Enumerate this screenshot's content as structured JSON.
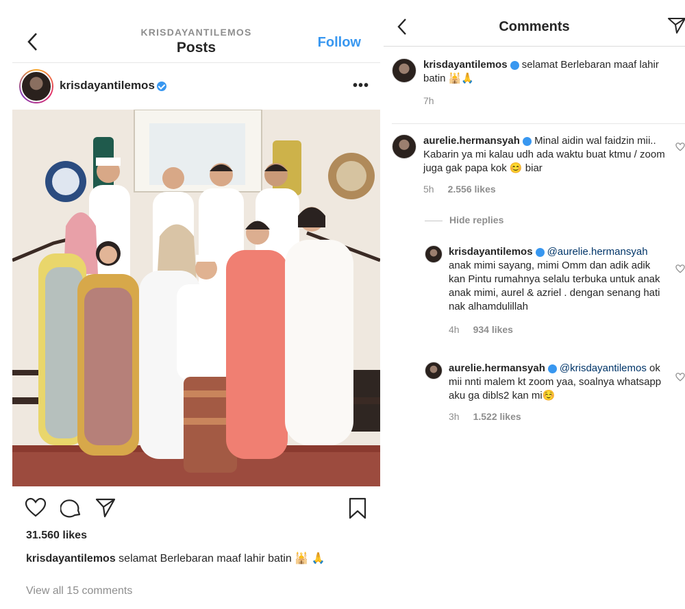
{
  "left": {
    "header": {
      "account_label": "KRISDAYANTILEMOS",
      "title": "Posts",
      "follow_label": "Follow"
    },
    "post": {
      "username": "krisdayantilemos",
      "likes": "31.560 likes",
      "caption_username": "krisdayantilemos",
      "caption_text": " selamat Berlebaran maaf lahir batin 🕌 🙏",
      "view_all_comments": "View all 15 comments"
    },
    "icons": {
      "back": "chevron-left-icon",
      "more": "more-horizontal-icon",
      "like": "heart-icon",
      "comment": "comment-icon",
      "share": "paper-plane-icon",
      "save": "bookmark-icon"
    },
    "colors": {
      "follow": "#3897f0",
      "muted": "#8e8e8e",
      "text": "#262626"
    }
  },
  "right": {
    "header": {
      "title": "Comments"
    },
    "caption": {
      "username": "krisdayantilemos",
      "text": " selamat Berlebaran maaf lahir batin 🕌🙏",
      "time": "7h"
    },
    "comments": [
      {
        "username": "aurelie.hermansyah",
        "mention": "",
        "text": " Minal aidin wal faidzin mii.. Kabarin ya mi kalau udh ada waktu buat ktmu / zoom juga gak papa kok 😊 biar",
        "time": "5h",
        "likes": "2.556 likes"
      }
    ],
    "hide_replies": "Hide replies",
    "replies": [
      {
        "username": "krisdayantilemos",
        "mention": "@aurelie.hermansyah",
        "text": " anak mimi sayang, mimi Omm dan adik adik kan Pintu rumahnya selalu terbuka untuk anak anak mimi, aurel & azriel . dengan senang hati nak alhamdulillah",
        "time": "4h",
        "likes": "934 likes"
      },
      {
        "username": "aurelie.hermansyah",
        "mention": "@krisdayantilemos",
        "text": " ok mii nnti malem kt zoom yaa, soalnya whatsapp aku ga dibls2 kan mi☺️",
        "time": "3h",
        "likes": "1.522 likes"
      }
    ]
  }
}
